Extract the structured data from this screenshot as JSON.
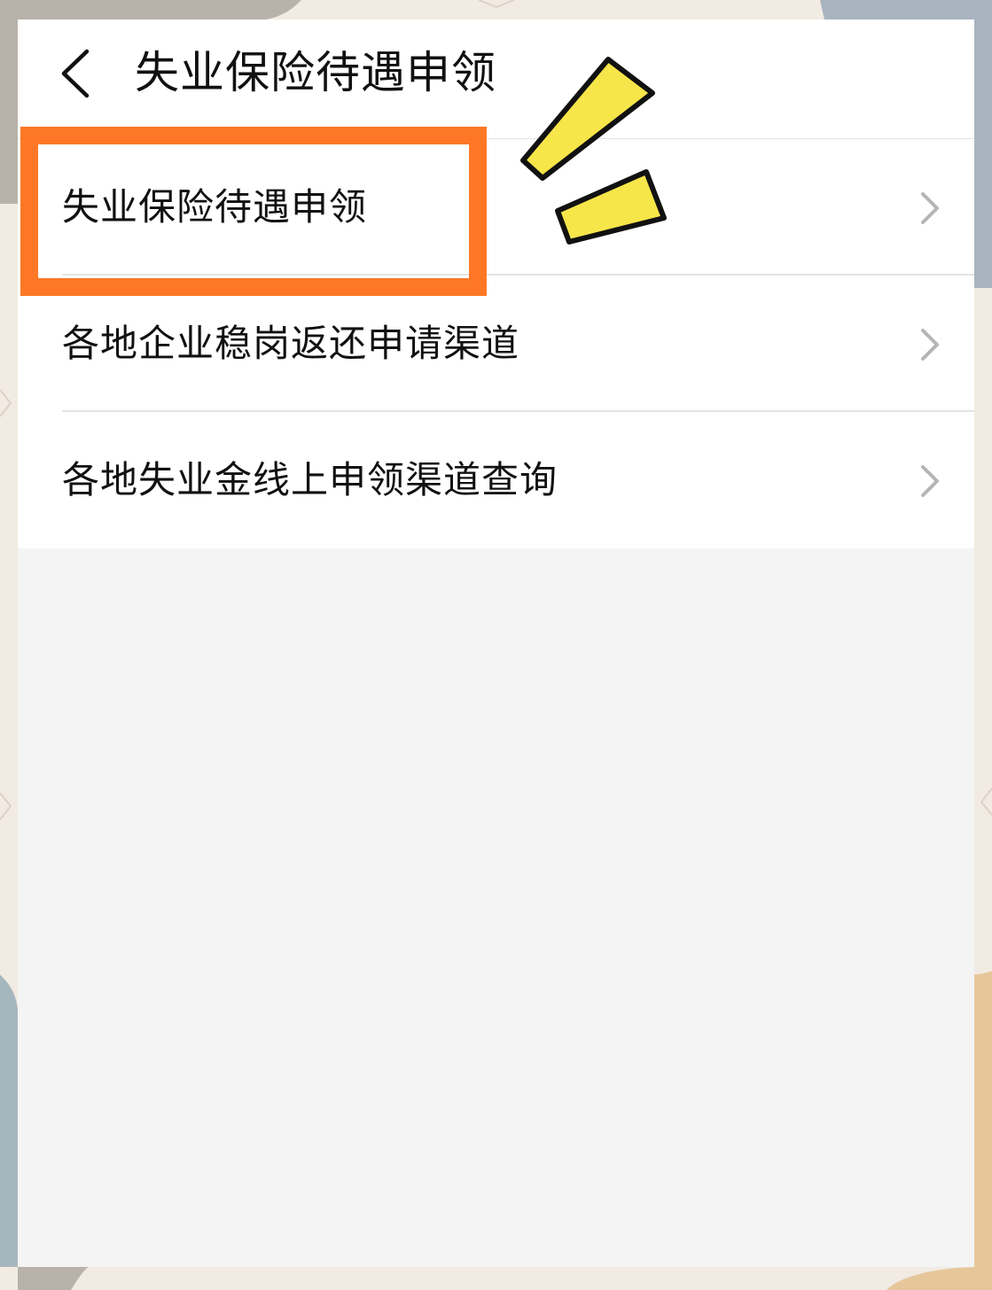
{
  "header": {
    "title": "失业保险待遇申领",
    "back_icon": "chevron-left-icon"
  },
  "list": {
    "items": [
      {
        "label": "失业保险待遇申领",
        "icon": "chevron-right-icon",
        "highlighted": true
      },
      {
        "label": "各地企业稳岗返还申请渠道",
        "icon": "chevron-right-icon",
        "highlighted": false
      },
      {
        "label": "各地失业金线上申领渠道查询",
        "icon": "chevron-right-icon",
        "highlighted": false
      }
    ]
  },
  "colors": {
    "highlight": "#fd7726",
    "sparkle": "#f7e64a",
    "chevron": "#b5b5b5",
    "text": "#111111"
  }
}
